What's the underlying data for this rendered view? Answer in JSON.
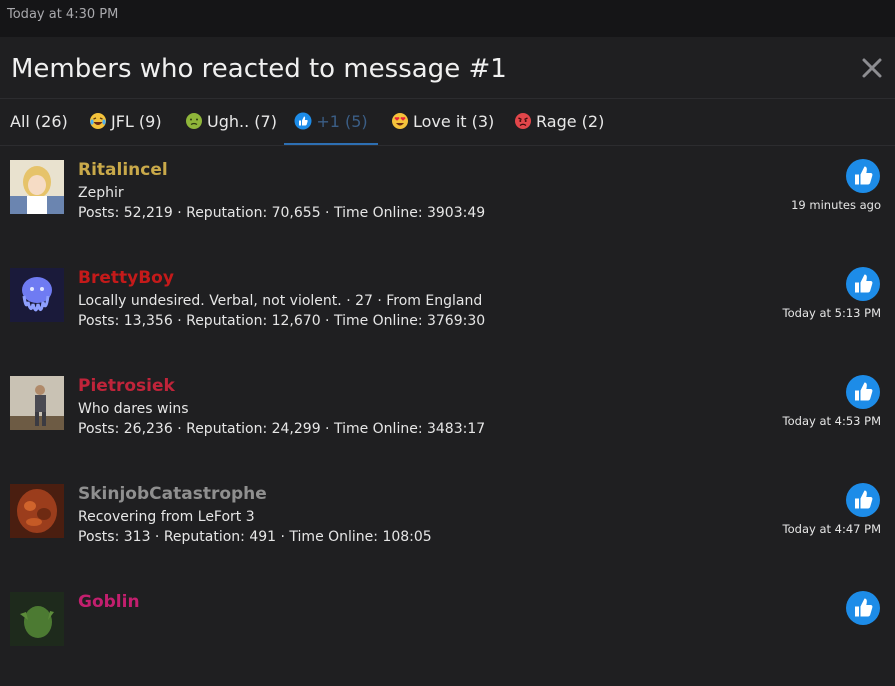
{
  "top_bar": {
    "text": "Today at 4:30 PM"
  },
  "dialog": {
    "title": "Members who reacted to message #1",
    "close_icon": "close-icon"
  },
  "tabs": [
    {
      "label": "All (26)",
      "icon": ""
    },
    {
      "label": "JFL (9)",
      "icon": "laughing-crying-emoji-icon"
    },
    {
      "label": "Ugh.. (7)",
      "icon": "nauseated-emoji-icon"
    },
    {
      "label": "+1 (5)",
      "icon": "thumbs-up-icon",
      "active": true
    },
    {
      "label": "Love it (3)",
      "icon": "heart-eyes-emoji-icon"
    },
    {
      "label": "Rage (2)",
      "icon": "angry-emoji-icon"
    }
  ],
  "members": [
    {
      "name": "Ritalincel",
      "name_color": "#c9a94a",
      "title": "Zephir",
      "stats": "Posts: 52,219 · Reputation: 70,655 · Time Online: 3903:49",
      "time": "19 minutes ago",
      "reaction_icon": "thumbs-up-icon"
    },
    {
      "name": "BrettyBoy",
      "name_color": "#c41a1a",
      "title": "Locally undesired. Verbal, not violent. · 27 · From England",
      "stats": "Posts: 13,356 · Reputation: 12,670 · Time Online: 3769:30",
      "time": "Today at 5:13 PM",
      "reaction_icon": "thumbs-up-icon"
    },
    {
      "name": "Pietrosiek",
      "name_color": "#c0243a",
      "title": "Who dares wins",
      "stats": "Posts: 26,236 · Reputation: 24,299 · Time Online: 3483:17",
      "time": "Today at 4:53 PM",
      "reaction_icon": "thumbs-up-icon"
    },
    {
      "name": "SkinjobCatastrophe",
      "name_color": "#8f8f8f",
      "title": "Recovering from LeFort 3",
      "stats": "Posts: 313 · Reputation: 491 · Time Online: 108:05",
      "time": "Today at 4:47 PM",
      "reaction_icon": "thumbs-up-icon"
    },
    {
      "name": "Goblin",
      "name_color": "#c21f6e",
      "title": "",
      "stats": "",
      "time": "",
      "reaction_icon": "thumbs-up-icon"
    }
  ],
  "colors": {
    "background": "#1f1f21",
    "top_bar": "#151517",
    "like_blue": "#1d8ce8",
    "active_tab": "#2d6fb3"
  }
}
